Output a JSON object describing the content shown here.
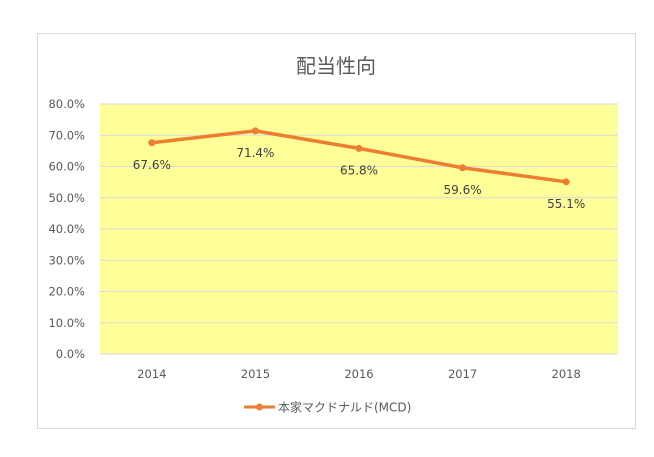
{
  "chart_data": {
    "type": "line",
    "title": "配当性向",
    "xlabel": "",
    "ylabel": "",
    "categories": [
      "2014",
      "2015",
      "2016",
      "2017",
      "2018"
    ],
    "series": [
      {
        "name": "本家マクドナルド(MCD)",
        "values": [
          67.6,
          71.4,
          65.8,
          59.6,
          55.1
        ],
        "data_labels": [
          "67.6%",
          "71.4%",
          "65.8%",
          "59.6%",
          "55.1%"
        ],
        "color": "#ed7d31"
      }
    ],
    "ylim": [
      0,
      80
    ],
    "y_ticks": [
      0,
      10,
      20,
      30,
      40,
      50,
      60,
      70,
      80
    ],
    "y_tick_labels": [
      "0.0%",
      "10.0%",
      "20.0%",
      "30.0%",
      "40.0%",
      "50.0%",
      "60.0%",
      "70.0%",
      "80.0%"
    ],
    "grid": true,
    "legend_position": "bottom",
    "plot_background": "#ffff99",
    "gridline_color": "#d9d9d9",
    "text_color": "#595959"
  }
}
